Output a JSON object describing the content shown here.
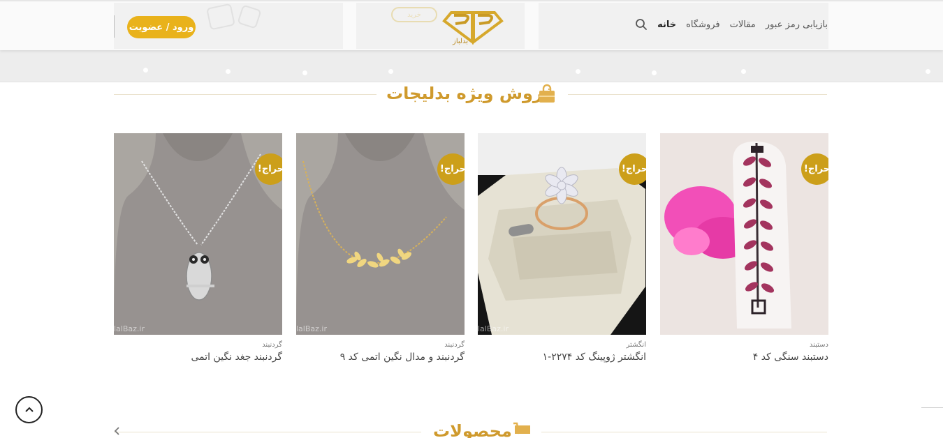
{
  "header": {
    "nav": [
      {
        "label": "خانه",
        "active": true
      },
      {
        "label": "فروشگاه",
        "active": false
      },
      {
        "label": "مقالات",
        "active": false
      },
      {
        "label": "بازیابی رمز عبور",
        "active": false
      }
    ],
    "login_label": "ورود / عضویت",
    "logo_text": "بدلباز",
    "banner_button_label": "خرید",
    "icons": {
      "search": "search-icon",
      "logo": "diamond-logo-icon"
    }
  },
  "special_sale": {
    "title": "فروش ویژه بدلیجات",
    "icon": "shopping-bag-icon",
    "accent_color": "#cf9a2d"
  },
  "products": [
    {
      "badge": "حراج!",
      "category": "دستبند",
      "name": "دستبند سنگی کد ۴",
      "image": "bracelet-photo",
      "watermark": ""
    },
    {
      "badge": "حراج!",
      "category": "انگشتر",
      "name": "انگشتر ژوپینگ کد ۲۲۷۴-۱",
      "image": "ring-photo",
      "watermark": "lalBaz.ir"
    },
    {
      "badge": "حراج!",
      "category": "گردنبند",
      "name": "گردنبند و مدال نگین اتمی کد ۹",
      "image": "gold-necklace-photo",
      "watermark": "lalBaz.ir"
    },
    {
      "badge": "حراج!",
      "category": "گردنبند",
      "name": "گردنبند جغد نگین اتمی",
      "image": "owl-necklace-photo",
      "watermark": "lalBaz.ir"
    }
  ],
  "products_section": {
    "title": "محصولات",
    "icon": "cart-icon"
  },
  "colors": {
    "accent": "#e9b21b",
    "badge": "#cc9f1a",
    "title": "#cf9a2d"
  }
}
